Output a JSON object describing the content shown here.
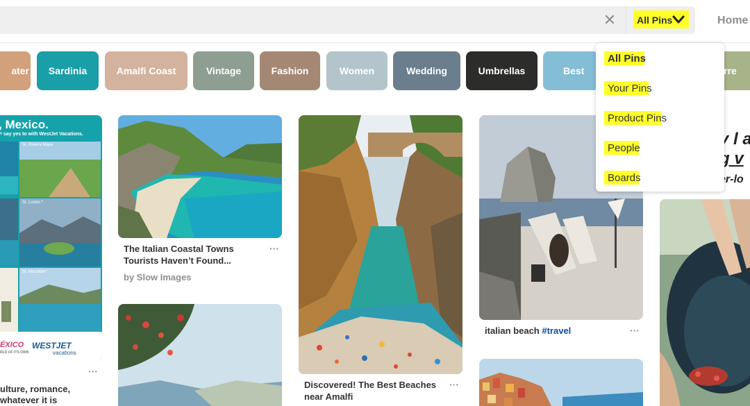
{
  "search": {
    "clear_icon": "close-icon",
    "scope_label": "All Pins",
    "scope_icon": "chevron-down-icon",
    "highlight_color": "#ffff2a"
  },
  "header": {
    "home_label": "Home"
  },
  "chips": [
    {
      "label": "ater",
      "color": "#d2a07b"
    },
    {
      "label": "Sardinia",
      "color": "#1a9ea7"
    },
    {
      "label": "Amalfi Coast",
      "color": "#d3b39d"
    },
    {
      "label": "Vintage",
      "color": "#8e9e92"
    },
    {
      "label": "Fashion",
      "color": "#a58874"
    },
    {
      "label": "Women",
      "color": "#b3c5cb"
    },
    {
      "label": "Wedding",
      "color": "#6b7e8d"
    },
    {
      "label": "Umbrellas",
      "color": "#2c2d2a"
    },
    {
      "label": "Best",
      "color": "#84bed6"
    },
    {
      "label": "rre",
      "color": "#a9b38a"
    }
  ],
  "dropdown": {
    "items": [
      {
        "label": "All Pins",
        "selected": true
      },
      {
        "label": "Your Pins",
        "selected": false
      },
      {
        "label": "Product Pins",
        "selected": false
      },
      {
        "label": "People",
        "selected": false
      },
      {
        "label": "Boards",
        "selected": false
      }
    ]
  },
  "pins": {
    "ad": {
      "headline": ", Mexico.",
      "subline": "ᵒ say yes to with WestJet Vacations.",
      "places": [
        "Sí, Riviera Maya",
        "Sí, Loreto *",
        "Sí, Mazatlan*"
      ],
      "logo_left": "ÉXICO",
      "logo_left_sub": "RLD OF ITS OWN",
      "logo_right": "WESTJET",
      "logo_right_sub": "vacations",
      "caption_line1": "ulture, romance,",
      "caption_line2": "whatever it is"
    },
    "coastal": {
      "title_line1": "The Italian Coastal Towns",
      "title_line2": "Tourists Haven’t Found...",
      "by": "by Slow Images"
    },
    "amalfi": {
      "title_line1": "Discovered! The Best Beaches",
      "title_line2": "near Amalfi"
    },
    "beach": {
      "title": "italian beach ",
      "tag": "#travel"
    },
    "right": {
      "line1": "y l a",
      "line2": "g v",
      "line3": "er-lo"
    },
    "more_label": "···"
  }
}
